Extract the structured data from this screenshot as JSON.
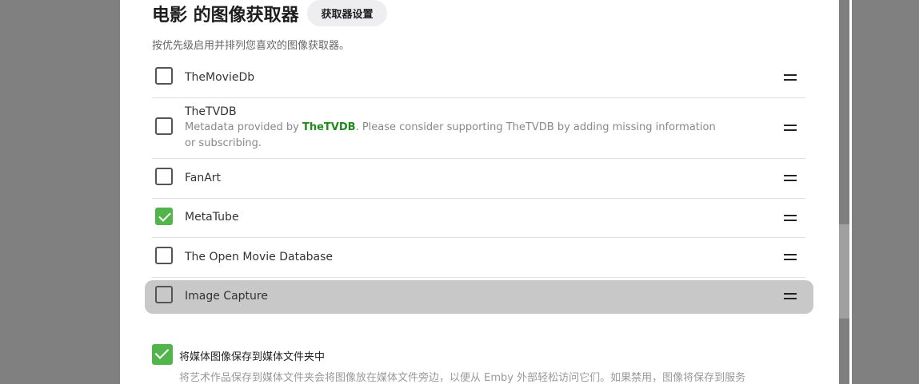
{
  "header": {
    "title": "电影 的图像获取器",
    "settings_button": "获取器设置",
    "subtitle": "按优先级启用并排列您喜欢的图像获取器。"
  },
  "fetchers": [
    {
      "name": "TheMovieDb",
      "checked": false
    },
    {
      "name": "TheTVDB",
      "checked": false,
      "desc_prefix": "Metadata provided by ",
      "desc_link": "TheTVDB",
      "desc_suffix": ". Please consider supporting TheTVDB by adding missing information or subscribing."
    },
    {
      "name": "FanArt",
      "checked": false
    },
    {
      "name": "MetaTube",
      "checked": true
    },
    {
      "name": "The Open Movie Database",
      "checked": false
    },
    {
      "name": "Image Capture",
      "checked": false,
      "highlighted": true
    }
  ],
  "save_option": {
    "label": "将媒体图像保存到媒体文件夹中",
    "checked": true,
    "description": "将艺术作品保存到媒体文件夹会将图像放在媒体文件旁边，以便从 Emby 外部轻松访问它们。如果禁用，图像将保存到服务"
  },
  "colors": {
    "accent_green": "#52b54b",
    "link_green": "#1f8b1f",
    "overlay": "#808080"
  },
  "icons": {
    "drag_handle": "drag-handle-icon",
    "checkmark": "checkmark-icon"
  }
}
